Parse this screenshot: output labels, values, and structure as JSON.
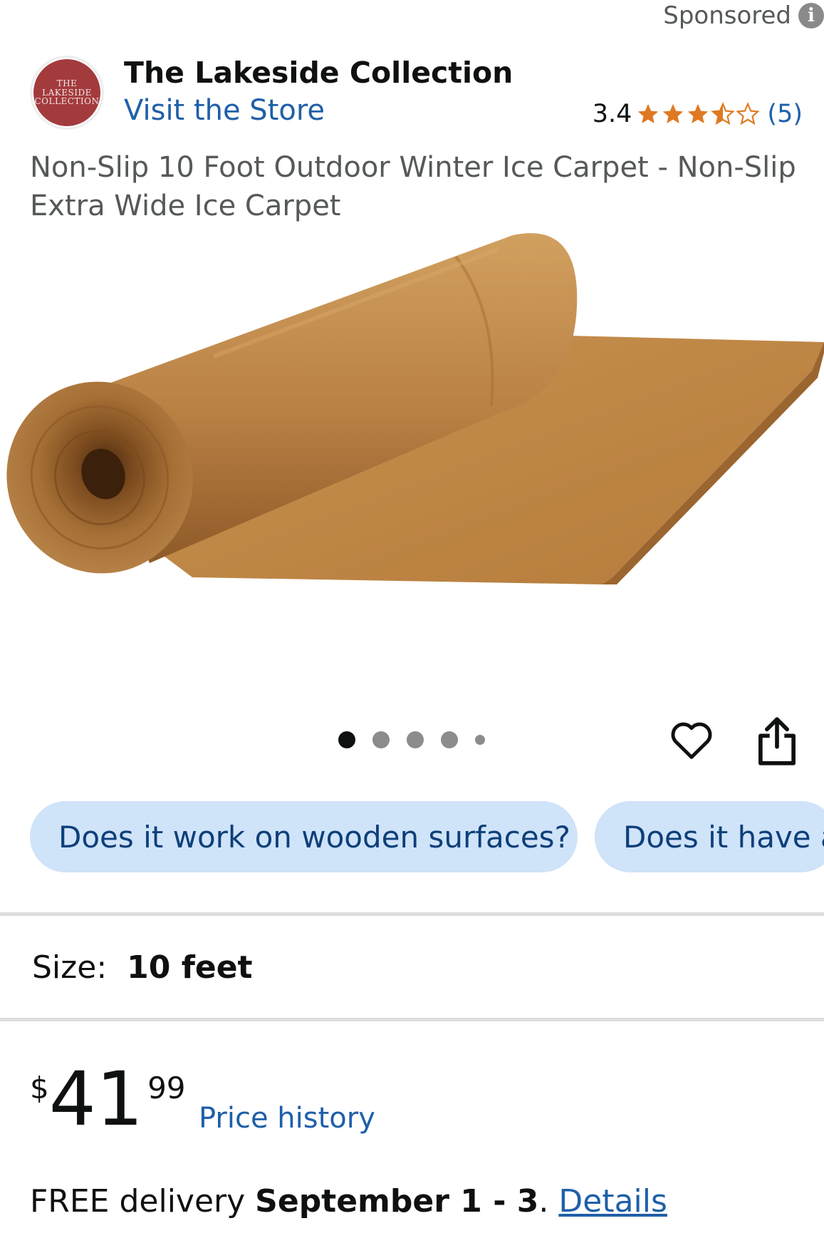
{
  "header": {
    "sponsored_label": "Sponsored",
    "info_icon": "i"
  },
  "store": {
    "logo_text": "THE LAKESIDE COLLECTION",
    "name": "The Lakeside Collection",
    "visit_label": "Visit the Store"
  },
  "rating": {
    "value": "3.4",
    "count": "(5)",
    "stars": 3.5
  },
  "product": {
    "title": "Non-Slip 10 Foot Outdoor Winter Ice Carpet - Non-Slip Extra Wide Ice Carpet"
  },
  "gallery": {
    "dot_count": 5,
    "active_index": 0
  },
  "questions": [
    "Does it work on wooden surfaces?",
    "Does it have a"
  ],
  "size": {
    "label": "Size:",
    "value": "10 feet"
  },
  "price": {
    "symbol": "$",
    "whole": "41",
    "fraction": "99",
    "history_label": "Price history"
  },
  "delivery": {
    "prefix": "FREE delivery",
    "date": "September 1 - 3",
    "separator": ".",
    "details_label": "Details"
  },
  "colors": {
    "link": "#1f5fa8",
    "star": "#de7921",
    "chip_bg": "#cfe3f9",
    "logo": "#a33b3d"
  }
}
